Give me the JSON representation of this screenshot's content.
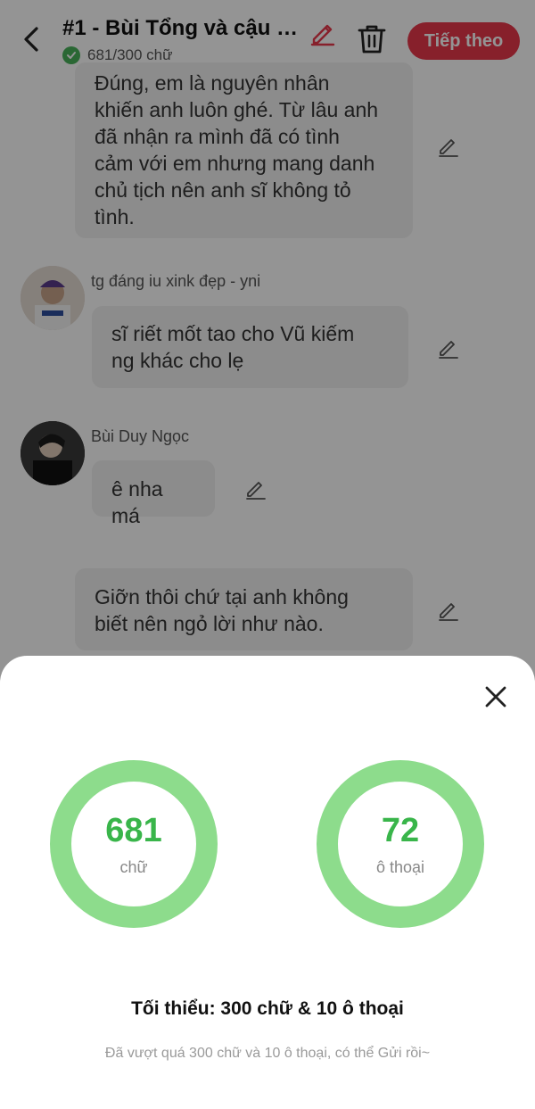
{
  "header": {
    "title": "#1 - Bùi Tổng và cậu c...",
    "word_count": "681/300 chữ",
    "next_label": "Tiếp theo"
  },
  "messages": [
    {
      "sender": "",
      "text_lines": [
        "Đúng, em là nguyên nhân",
        "khiến anh luôn ghé. Từ lâu anh",
        "đã nhận ra mình đã có tình",
        "cảm với em nhưng mang danh",
        "chủ tịch nên anh sĩ không tỏ",
        "tình."
      ]
    },
    {
      "sender": "tg đáng iu xink đẹp - yni",
      "text_lines": [
        "sĩ riết mốt tao cho Vũ kiếm",
        "ng khác cho lẹ"
      ]
    },
    {
      "sender": "Bùi Duy Ngọc",
      "text_lines": [
        "ê nha má"
      ]
    },
    {
      "sender": "",
      "text_lines": [
        "Giỡn thôi chứ tại anh không",
        "biết nên ngỏ lời như nào."
      ]
    }
  ],
  "stats": {
    "words_value": "681",
    "words_label": "chữ",
    "dialogues_value": "72",
    "dialogues_label": "ô thoại",
    "ring_color": "#8ddc8c",
    "value_color": "#39b54a",
    "minimum": "Tối thiểu: 300 chữ & 10 ô thoại",
    "hint": "Đã vượt quá 300 chữ và 10 ô thoại, có thể Gửi rồi~"
  },
  "colors": {
    "accent": "#e8374b",
    "check": "#49b25b",
    "bubble": "#f2f2f2"
  },
  "icons": [
    "back-arrow-icon",
    "check-icon",
    "pencil-icon",
    "trash-icon",
    "close-icon"
  ]
}
